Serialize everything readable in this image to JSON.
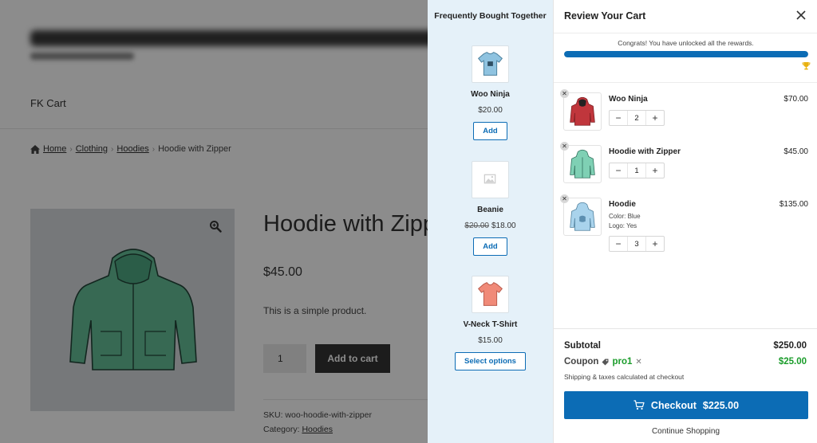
{
  "store": {
    "nav_label": "FK Cart",
    "breadcrumb": [
      "Home",
      "Clothing",
      "Hoodies",
      "Hoodie with Zipper"
    ],
    "product_title": "Hoodie with Zipper",
    "product_price": "$45.00",
    "product_description": "This is a simple product.",
    "quantity": "1",
    "add_to_cart_label": "Add to cart",
    "sku_label": "SKU: woo-hoodie-with-zipper",
    "category_label": "Category:",
    "category_value": "Hoodies"
  },
  "upsell": {
    "title": "Frequently Bought Together",
    "items": [
      {
        "name": "Woo Ninja",
        "old_price": "",
        "price": "$20.00",
        "button": "Add",
        "thumb": "tshirt-blue"
      },
      {
        "name": "Beanie",
        "old_price": "$20.00",
        "price": "$18.00",
        "button": "Add",
        "thumb": "placeholder"
      },
      {
        "name": "V-Neck T-Shirt",
        "old_price": "",
        "price": "$15.00",
        "button": "Select options",
        "thumb": "tshirt-red"
      }
    ]
  },
  "cart": {
    "title": "Review Your Cart",
    "rewards_message": "Congrats! You have unlocked all the rewards.",
    "rewards_progress": 1.0,
    "items": [
      {
        "name": "Woo Ninja",
        "price": "$70.00",
        "qty": "2",
        "variants": [],
        "thumb": "hoodie-red"
      },
      {
        "name": "Hoodie with Zipper",
        "price": "$45.00",
        "qty": "1",
        "variants": [],
        "thumb": "hoodie-green"
      },
      {
        "name": "Hoodie",
        "price": "$135.00",
        "qty": "3",
        "variants": [
          "Color: Blue",
          "Logo: Yes"
        ],
        "thumb": "hoodie-blue"
      }
    ],
    "subtotal_label": "Subtotal",
    "subtotal_value": "$250.00",
    "coupon_label": "Coupon",
    "coupon_code": "pro1",
    "coupon_value": "$25.00",
    "shipping_note": "Shipping & taxes calculated at checkout",
    "checkout_label": "Checkout",
    "checkout_total": "$225.00",
    "continue_label": "Continue Shopping"
  },
  "colors": {
    "accent": "#0c6cb5",
    "upsell_bg": "#e5f1f9",
    "coupon_green": "#1a9c2a"
  }
}
